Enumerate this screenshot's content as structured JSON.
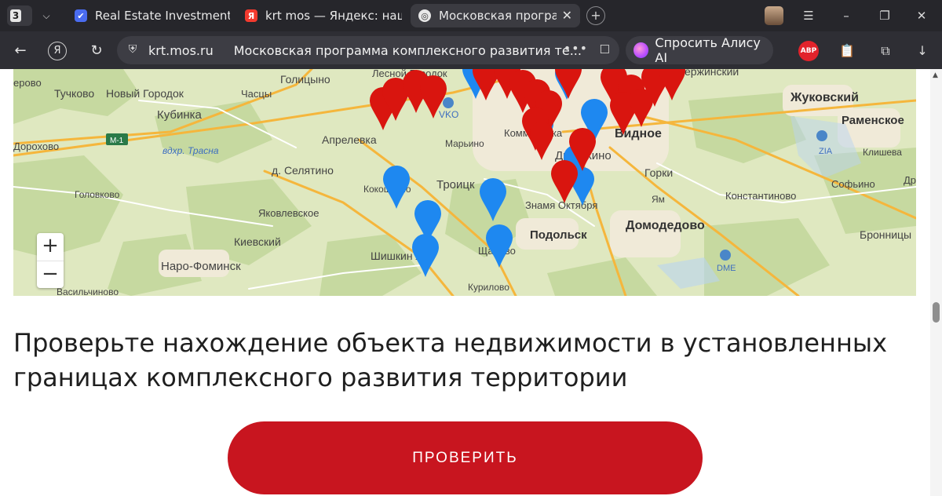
{
  "browser": {
    "tab_count": "3",
    "tabs": [
      {
        "title": "Real Estate Investment Analy"
      },
      {
        "title": "krt mos — Яндекс: нашлось"
      },
      {
        "title": "Московская программа"
      }
    ],
    "url_domain": "krt.mos.ru",
    "page_title": "Московская программа комплексного развития те...",
    "alice_label": "Спросить Алису AI",
    "adblock_label": "ABP"
  },
  "map": {
    "place_labels": [
      {
        "text": "Голицыно"
      },
      {
        "text": "Лесной Городок"
      },
      {
        "text": "ержинский"
      },
      {
        "text": "ерово"
      },
      {
        "text": "Тучково"
      },
      {
        "text": "Новый Городок"
      },
      {
        "text": "Часцы"
      },
      {
        "text": "Жуковский"
      },
      {
        "text": "Кубинка"
      },
      {
        "text": "VKO"
      },
      {
        "text": "Раменское"
      },
      {
        "text": "Дорохово"
      },
      {
        "text": "М-1"
      },
      {
        "text": "вдхр. Трасна"
      },
      {
        "text": "Апрелевка"
      },
      {
        "text": "Марьино"
      },
      {
        "text": "Видное"
      },
      {
        "text": "ZIA"
      },
      {
        "text": "Клишева"
      },
      {
        "text": "д. Селятино"
      },
      {
        "text": "Горки"
      },
      {
        "text": "Софьино"
      },
      {
        "text": "Троицк"
      },
      {
        "text": "Головково"
      },
      {
        "text": "Константиново"
      },
      {
        "text": "Знамя Октября"
      },
      {
        "text": "Ям"
      },
      {
        "text": "Яковлевское"
      },
      {
        "text": "Домодедово"
      },
      {
        "text": "Подольск"
      },
      {
        "text": "Бронницы"
      },
      {
        "text": "Киевский"
      },
      {
        "text": "Шишкин Лес"
      },
      {
        "text": "Щапово"
      },
      {
        "text": "Наро-Фоминск"
      },
      {
        "text": "DME"
      },
      {
        "text": "Васильчиново"
      },
      {
        "text": "Курилово"
      },
      {
        "text": "Коммунарка"
      },
      {
        "text": "Дрожжино"
      },
      {
        "text": "Кокошкино"
      },
      {
        "text": "Др"
      }
    ],
    "zoom_in_label": "+",
    "zoom_out_label": "−",
    "marker_colors": {
      "red": "#d9150f",
      "blue": "#1e88f0"
    }
  },
  "main": {
    "heading": "Проверьте нахождение объекта недвижимости в установленных границах комплексного развития территории",
    "check_button_label": "ПРОВЕРИТЬ"
  }
}
